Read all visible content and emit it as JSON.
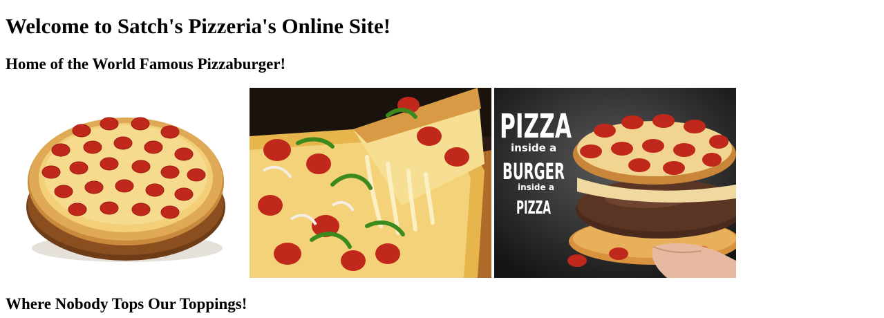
{
  "header": {
    "title": "Welcome to Satch's Pizzeria's Online Site!",
    "subtitle": "Home of the World Famous Pizzaburger!"
  },
  "gallery": {
    "images": [
      {
        "name": "pepperoni-pizza-photo"
      },
      {
        "name": "cheese-pull-pizza-slice-photo"
      },
      {
        "name": "pizza-burger-promo-photo",
        "promo_line1": "PIZZA",
        "promo_line2": "inside a",
        "promo_line3": "BURGER",
        "promo_line4": "inside a",
        "promo_line5": "PIZZA"
      }
    ]
  },
  "footer": {
    "tagline": "Where Nobody Tops Our Toppings!"
  },
  "colors": {
    "background": "#ffffff",
    "text": "#000000",
    "pepperoni": "#c0281c",
    "crust": "#d9a054",
    "cheese": "#f3d98a",
    "pepper": "#3c8a1e",
    "promo_bg": "#1c1c1c"
  }
}
